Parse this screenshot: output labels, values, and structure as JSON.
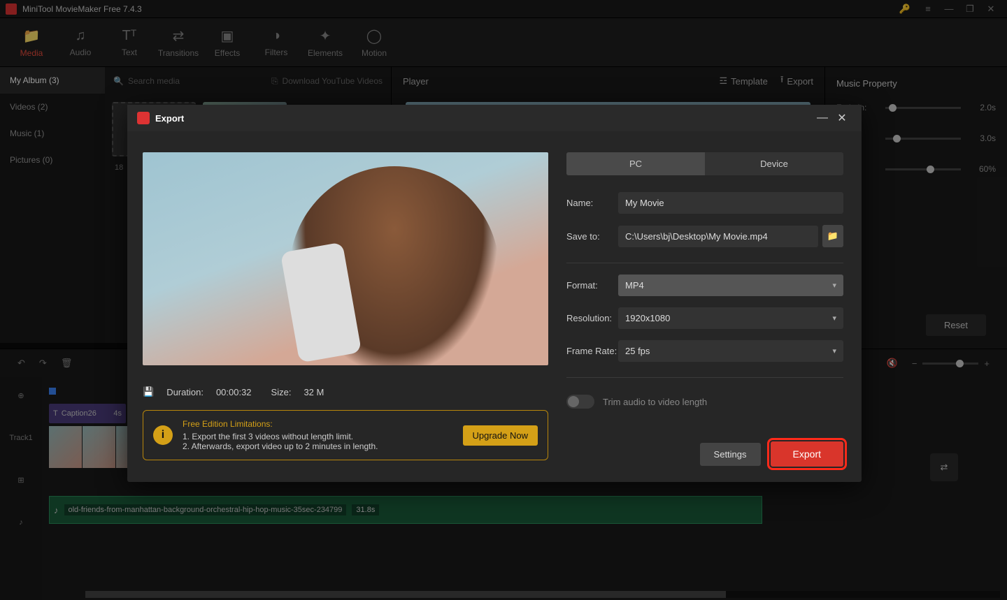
{
  "app": {
    "title": "MiniTool MovieMaker Free 7.4.3"
  },
  "toolbar": {
    "media": "Media",
    "audio": "Audio",
    "text": "Text",
    "transitions": "Transitions",
    "effects": "Effects",
    "filters": "Filters",
    "elements": "Elements",
    "motion": "Motion"
  },
  "player": {
    "label": "Player",
    "template": "Template",
    "export": "Export"
  },
  "props": {
    "title": "Music Property",
    "fadein_label": "Fade in:",
    "fadein_val": "2.0s",
    "fadeout_val": "3.0s",
    "vol_val": "60%",
    "reset": "Reset"
  },
  "sidebar": {
    "album": "My Album (3)",
    "videos": "Videos (2)",
    "music": "Music (1)",
    "pictures": "Pictures (0)"
  },
  "media": {
    "search_ph": "Search media",
    "download": "Download YouTube Videos",
    "thumb_label": "18"
  },
  "timeline": {
    "track1": "Track1",
    "caption": "Caption26",
    "caption_time": "4s",
    "audio_name": "old-friends-from-manhattan-background-orchestral-hip-hop-music-35sec-234799",
    "audio_dur": "31.8s"
  },
  "export": {
    "title": "Export",
    "tab_pc": "PC",
    "tab_device": "Device",
    "name_label": "Name:",
    "name_val": "My Movie",
    "saveto_label": "Save to:",
    "saveto_val": "C:\\Users\\bj\\Desktop\\My Movie.mp4",
    "format_label": "Format:",
    "format_val": "MP4",
    "res_label": "Resolution:",
    "res_val": "1920x1080",
    "fps_label": "Frame Rate:",
    "fps_val": "25 fps",
    "trim_label": "Trim audio to video length",
    "duration_label": "Duration:",
    "duration_val": "00:00:32",
    "size_label": "Size:",
    "size_val": "32 M",
    "limit_hdr": "Free Edition Limitations:",
    "limit_1": "1. Export the first 3 videos without length limit.",
    "limit_2": "2. Afterwards, export video up to 2 minutes in length.",
    "upgrade": "Upgrade Now",
    "settings": "Settings",
    "export_btn": "Export"
  }
}
